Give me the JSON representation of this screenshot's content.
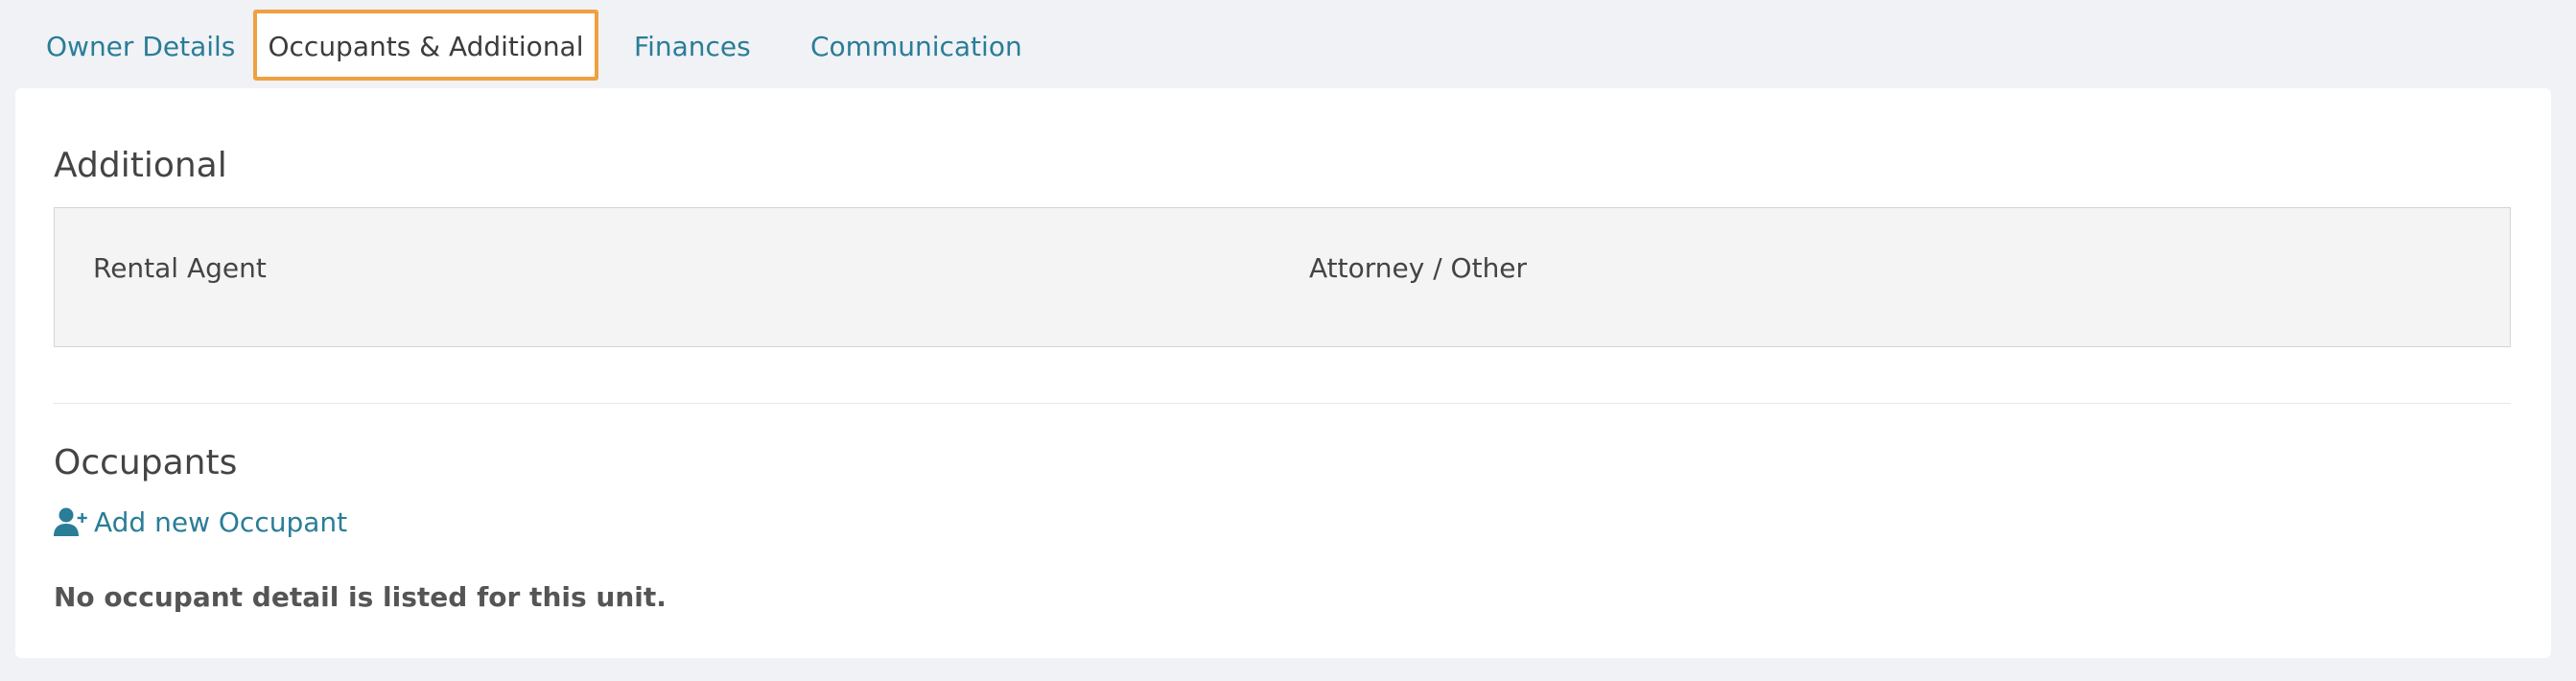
{
  "tabs": [
    {
      "label": "Owner Details",
      "active": false
    },
    {
      "label": "Occupants & Additional",
      "active": true
    },
    {
      "label": "Finances",
      "active": false
    },
    {
      "label": "Communication",
      "active": false
    }
  ],
  "additional": {
    "title": "Additional",
    "rental_agent_label": "Rental Agent",
    "attorney_label": "Attorney / Other"
  },
  "occupants": {
    "title": "Occupants",
    "add_icon": "user-plus-icon",
    "add_label": "Add new Occupant",
    "empty_message": "No occupant detail is listed for this unit."
  },
  "colors": {
    "link": "#2a7d97",
    "active_tab_border": "#f0a040",
    "page_bg": "#f0f2f6",
    "panel_bg": "#f4f4f4"
  }
}
